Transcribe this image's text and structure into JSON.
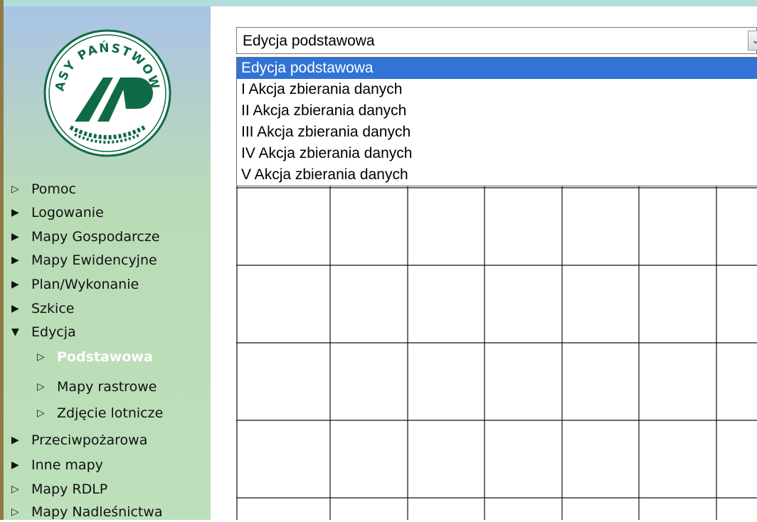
{
  "logo": {
    "text": "LASY PAŃSTWOWE",
    "icon": "lp-monogram-icon"
  },
  "nav": {
    "items": [
      {
        "label": "Pomoc",
        "arrow": "▷"
      },
      {
        "label": "Logowanie",
        "arrow": "▶"
      },
      {
        "label": "Mapy Gospodarcze",
        "arrow": "▶"
      },
      {
        "label": "Mapy Ewidencyjne",
        "arrow": "▶"
      },
      {
        "label": "Plan/Wykonanie",
        "arrow": "▶"
      },
      {
        "label": "Szkice",
        "arrow": "▶"
      },
      {
        "label": "Edycja",
        "arrow": "▼"
      },
      {
        "label": "Podstawowa",
        "arrow": "▷"
      },
      {
        "label": "Mapy rastrowe",
        "arrow": "▷"
      },
      {
        "label": "Zdjęcie lotnicze",
        "arrow": "▷"
      },
      {
        "label": "Przeciwpożarowa",
        "arrow": "▶"
      },
      {
        "label": "Inne mapy",
        "arrow": "▶"
      },
      {
        "label": "Mapy RDLP",
        "arrow": "▷"
      },
      {
        "label": "Mapy Nadleśnictwa",
        "arrow": "▷"
      }
    ]
  },
  "select": {
    "value": "Edycja podstawowa",
    "dropdown_icon": "chevron-down-icon",
    "options": [
      "Edycja podstawowa",
      "I Akcja zbierania danych",
      "II Akcja zbierania danych",
      "III Akcja zbierania danych",
      "IV Akcja zbierania danych",
      "V Akcja zbierania danych"
    ],
    "selected_index": 0
  },
  "colors": {
    "highlight": "#3173d7",
    "logo_green": "#0f6b46",
    "sidebar_green": "#bde0bb"
  }
}
